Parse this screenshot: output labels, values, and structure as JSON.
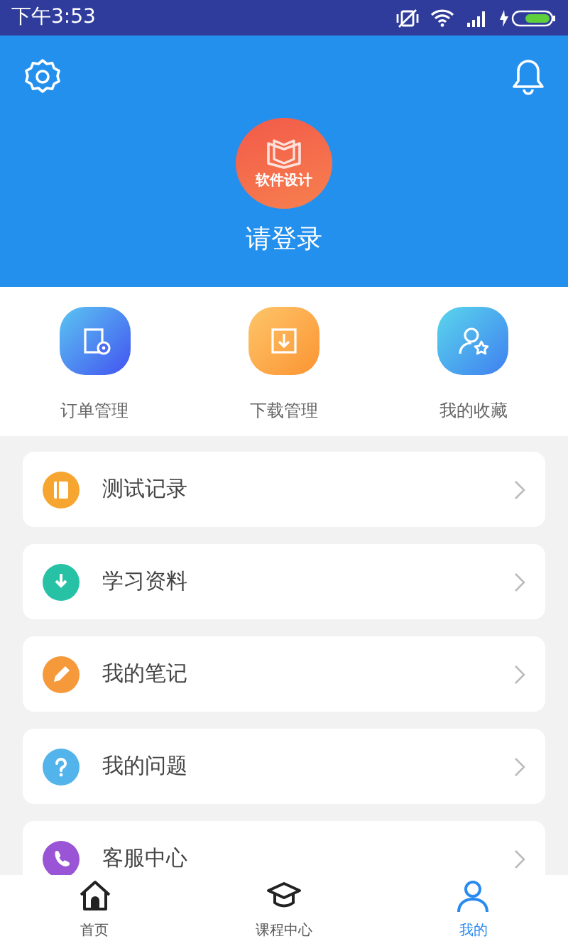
{
  "status_bar": {
    "time": "下午3:53"
  },
  "header": {
    "logo_caption": "软件设计",
    "login_prompt": "请登录"
  },
  "shortcuts": [
    {
      "label": "订单管理",
      "kind": "order"
    },
    {
      "label": "下载管理",
      "kind": "download"
    },
    {
      "label": "我的收藏",
      "kind": "favorite"
    }
  ],
  "menu": [
    {
      "label": "测试记录",
      "kind": "record",
      "color": "#f7a531"
    },
    {
      "label": "学习资料",
      "kind": "material",
      "color": "#27c2a6"
    },
    {
      "label": "我的笔记",
      "kind": "note",
      "color": "#f5993a"
    },
    {
      "label": "我的问题",
      "kind": "question",
      "color": "#52b4ea"
    },
    {
      "label": "客服中心",
      "kind": "service",
      "color": "#9a55d6"
    }
  ],
  "tab_bar": [
    {
      "label": "首页",
      "kind": "home",
      "selected": false
    },
    {
      "label": "课程中心",
      "kind": "course",
      "selected": false
    },
    {
      "label": "我的",
      "kind": "me",
      "selected": true
    }
  ]
}
